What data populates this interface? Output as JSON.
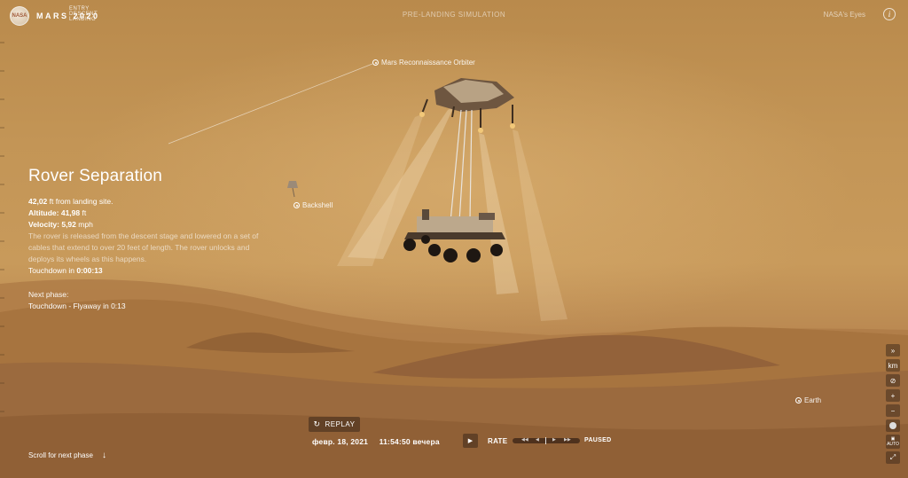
{
  "header": {
    "logo": "NASA",
    "mission_title": "MARS 2020",
    "mission_subtitle": "ENTRY DESCENT LANDING",
    "center_title": "PRE-LANDING SIMULATION",
    "brand": "NASA's Eyes",
    "info_icon": "i"
  },
  "phase": {
    "title": "Rover Separation",
    "distance_value": "42,02",
    "distance_text": "ft from landing site.",
    "altitude_label": "Altitude:",
    "altitude_value": "41,98",
    "altitude_unit": "ft",
    "velocity_label": "Velocity:",
    "velocity_value": "5,92",
    "velocity_unit": "mph",
    "description": "The rover is released from the descent stage and lowered on a set of cables that extend to over 20 feet of length. The rover unlocks and deploys its wheels as this happens.",
    "touchdown_label": "Touchdown in",
    "touchdown_value": "0:00:13",
    "next_label": "Next phase:",
    "next_value": "Touchdown - Flyaway in 0:13"
  },
  "labels_3d": {
    "orbiter": "Mars Reconnaissance Orbiter",
    "backshell": "Backshell",
    "earth": "Earth"
  },
  "scroll_hint": "Scroll for next phase",
  "playback": {
    "replay_label": "REPLAY",
    "date": "февр. 18, 2021",
    "time": "11:54:50 вечера",
    "rate_label": "RATE",
    "status": "PAUSED"
  },
  "side_tools": [
    "km",
    "+",
    "−",
    "AUTO"
  ],
  "colors": {
    "sky": "#c39556",
    "ground": "#9a6a3c",
    "panel": "#3c2819"
  }
}
